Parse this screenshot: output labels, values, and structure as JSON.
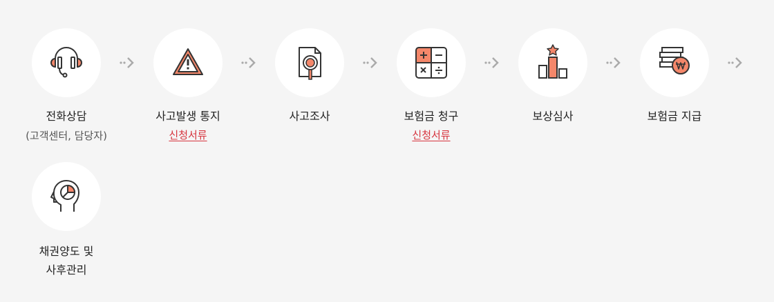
{
  "colors": {
    "accent": "#f4876a",
    "link": "#d6333d",
    "outline": "#333333"
  },
  "steps": [
    {
      "icon": "headset-icon",
      "title": "전화상담",
      "sub": "(고객센터, 담당자)"
    },
    {
      "icon": "warning-icon",
      "title": "사고발생 통지",
      "link": "신청서류"
    },
    {
      "icon": "document-search-icon",
      "title": "사고조사"
    },
    {
      "icon": "calculator-icon",
      "title": "보험금 청구",
      "link": "신청서류"
    },
    {
      "icon": "bar-chart-star-icon",
      "title": "보상심사"
    },
    {
      "icon": "money-stack-icon",
      "title": "보험금 지급"
    },
    {
      "icon": "head-chart-icon",
      "title_line1": "채권양도 및",
      "title_line2": "사후관리"
    }
  ]
}
